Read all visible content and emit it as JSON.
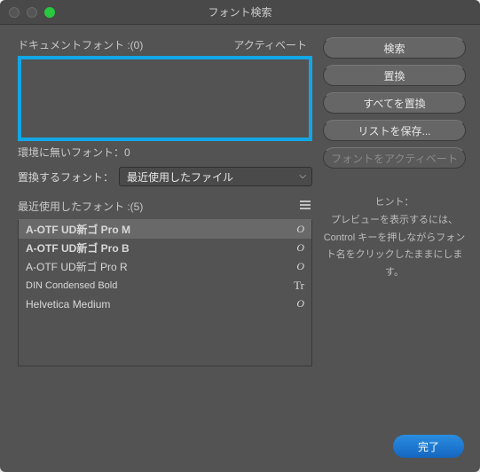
{
  "window": {
    "title": "フォント検索"
  },
  "labels": {
    "document_fonts": "ドキュメントフォント :(0)",
    "activate_col": "アクティベート",
    "missing_fonts": "環境に無いフォント：0",
    "replace_font": "置換するフォント：",
    "recent_fonts": "最近使用したフォント :(5)"
  },
  "select": {
    "value": "最近使用したファイル"
  },
  "buttons": {
    "search": "検索",
    "replace": "置換",
    "replace_all": "すべてを置換",
    "save_list": "リストを保存...",
    "activate_font": "フォントをアクティベート",
    "done": "完了"
  },
  "hint": {
    "title": "ヒント：",
    "body": "プレビューを表示するには、Control キーを押しながらフォント名をクリックしたままにします。"
  },
  "recent_list": [
    {
      "name": "A-OTF UD新ゴ Pro M",
      "badge": "O",
      "weight": "m",
      "selected": true
    },
    {
      "name": "A-OTF UD新ゴ Pro B",
      "badge": "O",
      "weight": "b",
      "selected": false
    },
    {
      "name": "A-OTF UD新ゴ Pro R",
      "badge": "O",
      "weight": "r",
      "selected": false
    },
    {
      "name": "DIN Condensed Bold",
      "badge": "Tr",
      "weight": "cond",
      "selected": false
    },
    {
      "name": "Helvetica Medium",
      "badge": "O",
      "weight": "r",
      "selected": false
    }
  ]
}
